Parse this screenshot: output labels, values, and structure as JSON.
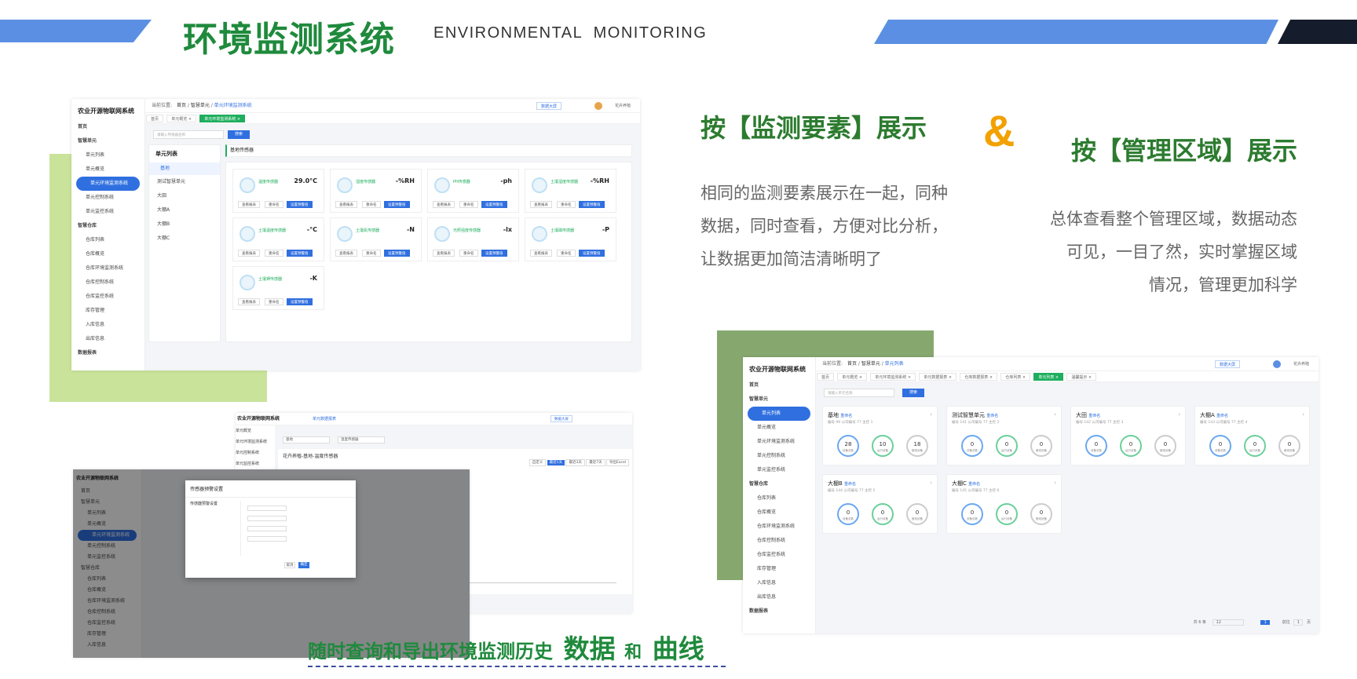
{
  "header": {
    "title": "环境监测系统",
    "subtitle": "ENVIRONMENTAL  MONITORING",
    "colors": {
      "blue_band": "#5b8fe3",
      "dark_band": "#151d2c",
      "title_green": "#1f8a3c"
    }
  },
  "section_elements": {
    "heading": "按【监测要素】展示",
    "ampersand": "&",
    "lines": [
      "相同的监测要素展示在一起，同种",
      "数据，同时查看，方便对比分析，",
      "让数据更加简洁清晰明了"
    ]
  },
  "section_areas": {
    "heading": "按【管理区域】展示",
    "lines": [
      "总体查看整个管理区域，数据动态",
      "可见，一目了然，实时掌握区域",
      "情况，管理更加科学"
    ]
  },
  "history": {
    "caption_prefix": "随时查询和导出环境监测历史",
    "caption_data": "数据",
    "caption_and": "和",
    "caption_curve": "曲线"
  },
  "app": {
    "brand": "农业开源物联网系统",
    "breadcrumb_label": "当前位置:",
    "bc_home": "首页",
    "bc_unit": "智慧单元",
    "bc_current1": "单元环境监测系统",
    "bc_current2": "单元列表",
    "bc_current3": "单元数据报表",
    "screen_btn": "数据大屏",
    "user": "花卉养殖",
    "menu": {
      "home": "首页",
      "smart_unit": "智慧单元",
      "unit_list": "单元列表",
      "unit_overview": "单元概览",
      "unit_env": "单元环境监测系统",
      "unit_ctrl": "单元控制系统",
      "unit_monitor": "单元监控系统",
      "smart_ware": "智慧仓库",
      "ware_list": "仓库列表",
      "ware_overview": "仓库概览",
      "ware_env": "仓库环境监测系统",
      "ware_ctrl": "仓库控制系统",
      "ware_monitor": "仓库监控系统",
      "stock": "库存管理",
      "in_stock": "入库信息",
      "out_stock": "出库信息",
      "report": "数据报表"
    },
    "tabs1": [
      "首页",
      "单元概览 ×",
      "单元环境监测系统 ×"
    ],
    "tabs2": [
      "首页",
      "单元概览 ×",
      "单元环境监测系统 ×",
      "单元数据报表 ×",
      "仓库数据报表 ×",
      "仓库列表 ×",
      "单元列表 ×",
      "温馨提示 ×"
    ],
    "search_placeholder": "请输入传感器名称",
    "search_placeholder2": "请输入单元名称",
    "search_btn": "搜索",
    "unit_panel_title": "单元列表",
    "unit_tree": [
      "基地",
      "测试智慧单元",
      "大田",
      "大棚A",
      "大棚B",
      "大棚C"
    ],
    "sensor_panel_title": "基地传感器",
    "sensors": [
      {
        "name": "温度传感器",
        "value": "29.0°C"
      },
      {
        "name": "湿度传感器",
        "value": "-%RH"
      },
      {
        "name": "PH传感器",
        "value": "-ph"
      },
      {
        "name": "土壤湿度传感器",
        "value": "-%RH"
      },
      {
        "name": "土壤温度传感器",
        "value": "-°C"
      },
      {
        "name": "土壤氮传感器",
        "value": "-N"
      },
      {
        "name": "光照强度传感器",
        "value": "-lx"
      },
      {
        "name": "土壤磷传感器",
        "value": "-P"
      },
      {
        "name": "土壤钾传感器",
        "value": "-K"
      }
    ],
    "sensor_btn_view": "查看报表",
    "sensor_btn_rename": "重命名",
    "sensor_btn_warn": "设置预警值",
    "units": [
      {
        "name": "基地",
        "tag": "重命名",
        "meta": "编号 99   公司编号 77   主控 1",
        "rings": [
          "28",
          "10",
          "18"
        ]
      },
      {
        "name": "测试智慧单元",
        "tag": "重命名",
        "meta": "编号 141   公司编号 77   主控 2",
        "rings": [
          "0",
          "0",
          "0"
        ]
      },
      {
        "name": "大田",
        "tag": "重命名",
        "meta": "编号 142   公司编号 77   主控 3",
        "rings": [
          "0",
          "0",
          "0"
        ]
      },
      {
        "name": "大棚A",
        "tag": "重命名",
        "meta": "编号 143   公司编号 77   主控 4",
        "rings": [
          "0",
          "0",
          "0"
        ]
      },
      {
        "name": "大棚B",
        "tag": "重命名",
        "meta": "编号 144   公司编号 77   主控 5",
        "rings": [
          "0",
          "0",
          "0"
        ]
      },
      {
        "name": "大棚C",
        "tag": "重命名",
        "meta": "编号 145   公司编号 77   主控 6",
        "rings": [
          "0",
          "0",
          "0"
        ]
      }
    ],
    "ring_labels": [
      "设备总数",
      "运行设备",
      "断线设备"
    ],
    "pager_total": "共 6 条",
    "pager_size": "12",
    "pager_page": "1",
    "pager_goto": "前往",
    "pager_unit": "页",
    "report_title": "花卉养殖-基地-温度传感器",
    "report_filters": [
      "基地",
      "温度传感器"
    ],
    "report_ranges": [
      "自定义",
      "最近1天",
      "最近3天",
      "最近7天",
      "导出Excel"
    ],
    "dialog_title": "传感器预警设置",
    "dialog_sub": "传感器预警设置",
    "dialog_cancel": "取消",
    "dialog_ok": "确定"
  }
}
